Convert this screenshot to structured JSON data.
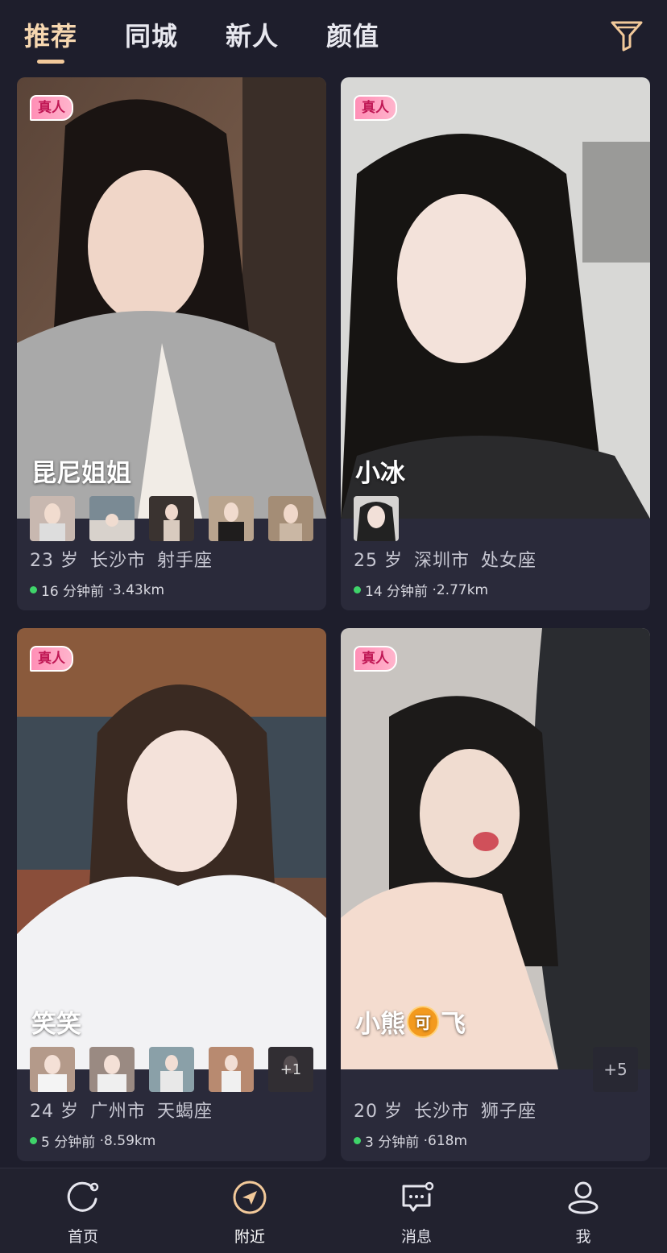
{
  "tabs": [
    {
      "label": "推荐",
      "active": true
    },
    {
      "label": "同城",
      "active": false
    },
    {
      "label": "新人",
      "active": false
    },
    {
      "label": "颜值",
      "active": false
    }
  ],
  "filter_icon": "filter-funnel-icon",
  "colors": {
    "background": "#1e1e2c",
    "accent": "#f6d7b0",
    "badge": "#ff8fb6",
    "online": "#3fd46a"
  },
  "cards": [
    {
      "badge": "真人",
      "name": "昆尼姐姐",
      "age": "23 岁",
      "city": "长沙市",
      "zodiac": "射手座",
      "active": "16 分钟前",
      "distance": "3.43km",
      "thumbs": 5
    },
    {
      "badge": "真人",
      "name": "小冰",
      "age": "25 岁",
      "city": "深圳市",
      "zodiac": "处女座",
      "active": "14 分钟前",
      "distance": "2.77km",
      "thumbs": 1
    },
    {
      "badge": "真人",
      "name": "笑笑",
      "age": "24 岁",
      "city": "广州市",
      "zodiac": "天蝎座",
      "active": "5 分钟前",
      "distance": "8.59km",
      "thumbs": 5,
      "thumb_more": "+1"
    },
    {
      "badge": "真人",
      "name_before": "小熊",
      "name_icon": "可",
      "name_after": "飞",
      "age": "20 岁",
      "city": "长沙市",
      "zodiac": "狮子座",
      "active": "3 分钟前",
      "distance": "618m",
      "more": "+5"
    }
  ],
  "nav": [
    {
      "label": "首页",
      "icon": "home-icon"
    },
    {
      "label": "附近",
      "icon": "nearby-icon",
      "active": true
    },
    {
      "label": "消息",
      "icon": "message-icon"
    },
    {
      "label": "我",
      "icon": "profile-icon"
    }
  ]
}
